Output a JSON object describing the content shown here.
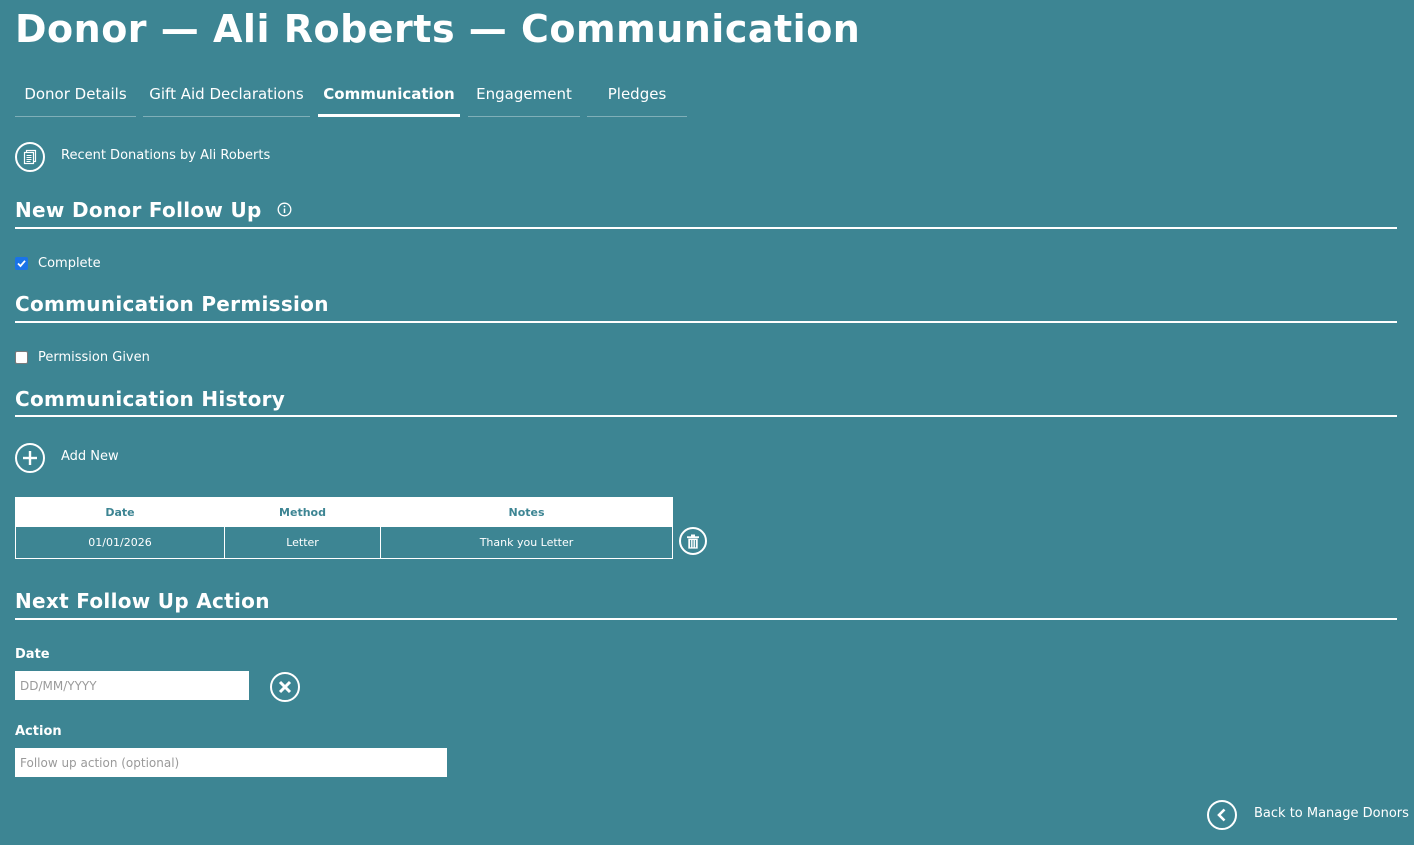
{
  "header": {
    "title": "Donor — Ali Roberts — Communication"
  },
  "tabs": [
    {
      "label": "Donor Details",
      "active": false
    },
    {
      "label": "Gift Aid Declarations",
      "active": false
    },
    {
      "label": "Communication",
      "active": true
    },
    {
      "label": "Engagement",
      "active": false
    },
    {
      "label": "Pledges",
      "active": false
    }
  ],
  "recent_donations": {
    "label": "Recent Donations by Ali Roberts",
    "icon": "documents-icon"
  },
  "new_donor_follow_up": {
    "title": "New Donor Follow Up",
    "info_icon": "info-icon",
    "complete_label": "Complete",
    "complete_checked": true
  },
  "communication_permission": {
    "title": "Communication Permission",
    "permission_label": "Permission Given",
    "permission_checked": false
  },
  "communication_history": {
    "title": "Communication History",
    "add_new_label": "Add New",
    "columns": [
      "Date",
      "Method",
      "Notes"
    ],
    "rows": [
      {
        "date": "01/01/2026",
        "method": "Letter",
        "notes": "Thank you Letter"
      }
    ]
  },
  "next_follow_up": {
    "title": "Next Follow Up Action",
    "date_label": "Date",
    "date_value": "",
    "date_placeholder": "DD/MM/YYYY",
    "action_label": "Action",
    "action_value": "",
    "action_placeholder": "Follow up action (optional)"
  },
  "footer": {
    "back_label": "Back to Manage Donors"
  },
  "colors": {
    "background": "#3d8593",
    "foreground": "#ffffff",
    "checkbox_accent": "#1a73e8"
  }
}
